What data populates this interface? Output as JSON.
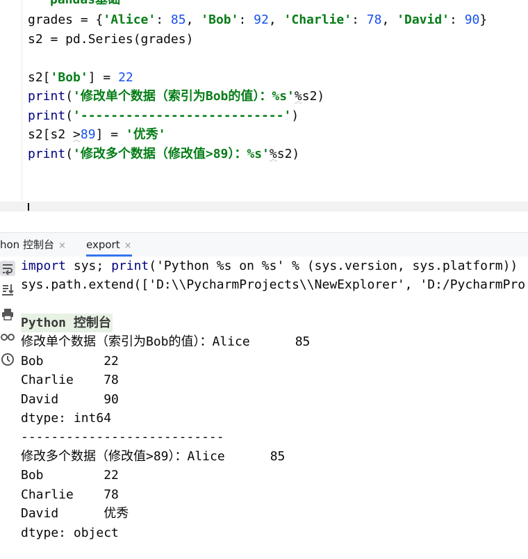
{
  "editor": {
    "top_partial": "pandas基础",
    "lines": [
      "grades = {'Alice': 85, 'Bob': 92, 'Charlie': 78, 'David': 90}",
      "s2 = pd.Series(grades)",
      "",
      "s2['Bob'] = 22",
      "print('修改单个数据（索引为Bob的值）：%s'%s2)",
      "print('---------------------------')",
      "s2[s2 >89] = '优秀'",
      "print('修改多个数据（修改值>89）：%s'%s2)"
    ]
  },
  "tabs": [
    {
      "label": "hon 控制台",
      "close": "×"
    },
    {
      "label": "export",
      "close": "×"
    }
  ],
  "console": {
    "lines": [
      "import sys; print('Python %s on %s' % (sys.version, sys.platform))",
      "sys.path.extend(['D:\\\\PycharmProjects\\\\NewExplorer', 'D:/PycharmPro",
      "",
      "Python 控制台",
      "修改单个数据（索引为Bob的值）：Alice      85",
      "Bob        22",
      "Charlie    78",
      "David      90",
      "dtype: int64",
      "---------------------------",
      "修改多个数据（修改值>89）：Alice      85",
      "Bob        22",
      "Charlie    78",
      "David      优秀",
      "dtype: object"
    ]
  },
  "icons": [
    "soft-wrap-icon",
    "scroll-to-end-icon",
    "print-icon",
    "glasses-icon",
    "history-icon"
  ],
  "colors": {
    "string": "#067d17",
    "number": "#1750eb",
    "keyword_fn": "#000080",
    "tab_active": "#3574f0"
  }
}
